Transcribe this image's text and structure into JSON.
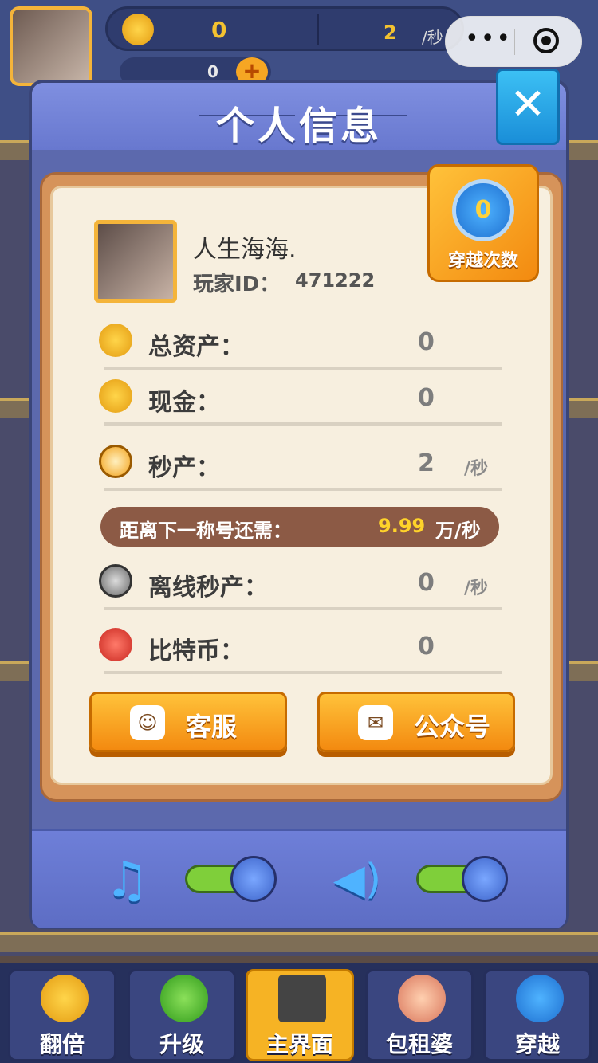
{
  "topbar": {
    "coins": "0",
    "rate": "2",
    "rate_unit": "/秒",
    "gems": "0",
    "plus": "+"
  },
  "modal": {
    "title": "个人信息",
    "close": "✕",
    "nickname": "人生海海.",
    "player_id_label": "玩家ID：",
    "player_id": "471222",
    "travel": {
      "count": "0",
      "label": "穿越次数"
    },
    "stats": [
      {
        "label": "总资产：",
        "value": "0",
        "unit": ""
      },
      {
        "label": "现金：",
        "value": "0",
        "unit": ""
      },
      {
        "label": "秒产：",
        "value": "2",
        "unit": "/秒"
      },
      {
        "label": "离线秒产：",
        "value": "0",
        "unit": "/秒"
      },
      {
        "label": "比特币：",
        "value": "0",
        "unit": ""
      }
    ],
    "next_title": {
      "label": "距离下一称号还需：",
      "value": "9.99",
      "unit": "万/秒"
    },
    "buttons": {
      "service": "客服",
      "official": "公众号"
    },
    "settings": {
      "music_on": true,
      "sound_on": true
    }
  },
  "nav": [
    {
      "label": "翻倍"
    },
    {
      "label": "升级"
    },
    {
      "label": "主界面"
    },
    {
      "label": "包租婆"
    },
    {
      "label": "穿越"
    }
  ],
  "colors": {
    "accent_orange": "#f6a623",
    "modal_blue": "#5c69ad",
    "toggle_green": "#7fcf3a"
  }
}
